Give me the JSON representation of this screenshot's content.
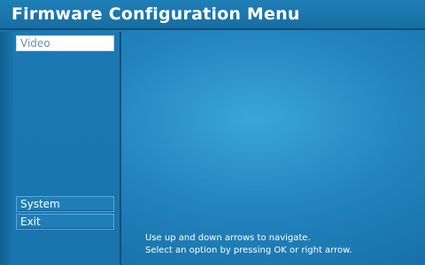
{
  "window": {
    "title": "Firmware Configuration Menu"
  },
  "sidebar": {
    "items": [
      {
        "label": "Video",
        "selected": true
      },
      {
        "label": "System",
        "selected": false
      },
      {
        "label": "Exit",
        "selected": false
      }
    ]
  },
  "help": {
    "line1": "Use up and down arrows to navigate.",
    "line2": "Select an option by pressing OK or right arrow."
  },
  "colors": {
    "background": "#2283bd",
    "title_text": "#ffffff",
    "selected_item_bg": "#ffffff",
    "selected_item_text": "#6b8fb0"
  }
}
